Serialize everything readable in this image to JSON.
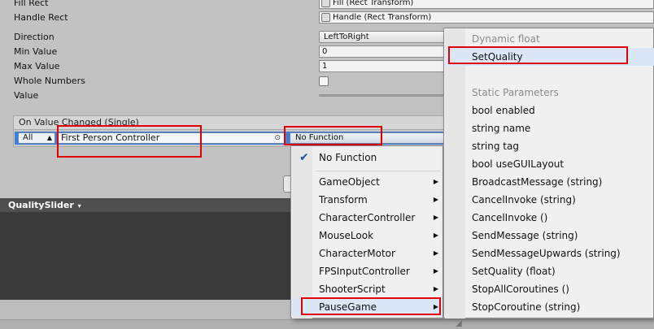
{
  "properties": {
    "fill_rect": {
      "label": "Fill Rect",
      "value": "Fill (Rect Transform)"
    },
    "handle_rect": {
      "label": "Handle Rect",
      "value": "Handle (Rect Transform)"
    },
    "direction": {
      "label": "Direction",
      "value": "LeftToRight"
    },
    "min_value": {
      "label": "Min Value",
      "value": "0"
    },
    "max_value": {
      "label": "Max Value",
      "value": "1"
    },
    "whole_numbers": {
      "label": "Whole Numbers",
      "checked": false
    },
    "value": {
      "label": "Value"
    }
  },
  "event": {
    "header": "On Value Changed (Single)",
    "runtime_option": "All",
    "target": "First Person Controller",
    "function": "No Function"
  },
  "panel": {
    "title": "QualitySlider"
  },
  "menu_components": {
    "selected": "No Function",
    "items": [
      "GameObject",
      "Transform",
      "CharacterController",
      "MouseLook",
      "CharacterMotor",
      "FPSInputController",
      "ShooterScript",
      "PauseGame"
    ]
  },
  "menu_methods": {
    "section_dynamic": "Dynamic float",
    "dynamic_items": [
      "SetQuality"
    ],
    "section_static": "Static Parameters",
    "static_items": [
      "bool enabled",
      "string name",
      "string tag",
      "bool useGUILayout",
      "BroadcastMessage (string)",
      "CancelInvoke (string)",
      "CancelInvoke ()",
      "SendMessage (string)",
      "SendMessageUpwards (string)",
      "SetQuality (float)",
      "StopAllCoroutines ()",
      "StopCoroutine (string)"
    ]
  },
  "icons": {
    "checkmark": "checkmark-icon",
    "submenu": "submenu-arrow-icon",
    "object_picker": "object-picker-icon",
    "dropdown": "dropdown-arrow-icon"
  },
  "colors": {
    "highlight_box": "#e00000",
    "selection": "#3d7fd6",
    "dark_panel": "#3a3a3a"
  }
}
